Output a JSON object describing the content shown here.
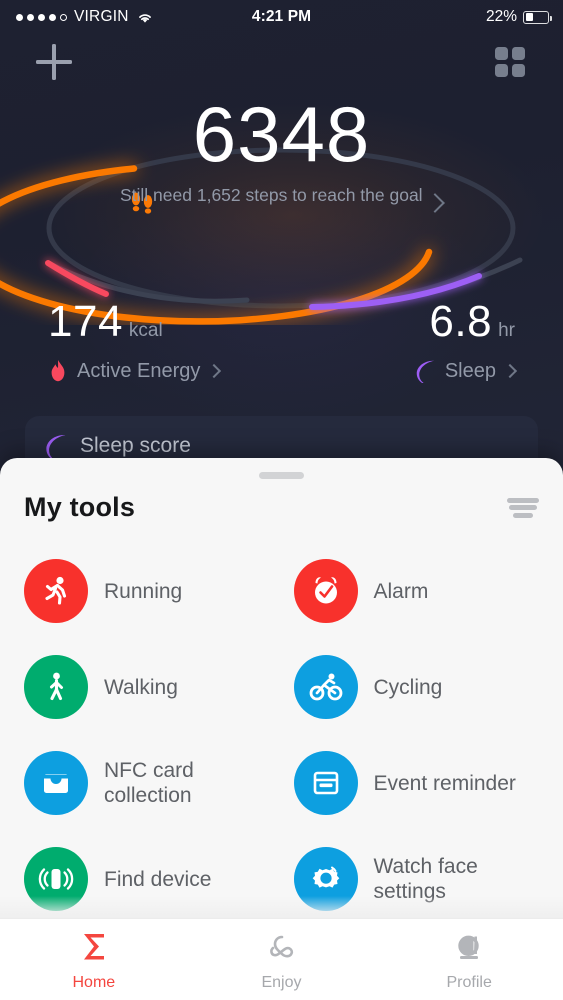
{
  "status_bar": {
    "carrier": "VIRGIN",
    "signal_dots_filled": 4,
    "signal_dots_total": 5,
    "wifi_icon": "wifi-icon",
    "time": "4:21 PM",
    "battery_percent": "22%",
    "battery_level": 22
  },
  "header": {
    "add_icon": "plus-icon",
    "grid_icon": "grid-apps-icon"
  },
  "steps_card": {
    "value": "6348",
    "message": "Still need 1,652 steps to reach the goal",
    "footprints_icon": "footprints-icon",
    "chevron_icon": "chevron-right-icon",
    "ring_color": "#fb7905",
    "ring_track_color": "#353a4a",
    "progress_percent": 79
  },
  "stats": [
    {
      "value": "174",
      "unit": "kcal",
      "label": "Active Energy",
      "icon": "flame-icon",
      "color": "#f8485e",
      "chevron_icon": "chevron-right-icon"
    },
    {
      "value": "6.8",
      "unit": "hr",
      "label": "Sleep",
      "icon": "moon-icon",
      "color": "#9d5ef5",
      "chevron_icon": "chevron-right-icon"
    }
  ],
  "sleep_score_card": {
    "label": "Sleep score",
    "icon": "moon-icon"
  },
  "sheet": {
    "title": "My tools",
    "sort_icon": "sort-filter-icon",
    "handle": "drag-handle",
    "tools": [
      {
        "label": "Running",
        "icon": "running-icon",
        "color": "#f8312c"
      },
      {
        "label": "Alarm",
        "icon": "alarm-clock-icon",
        "color": "#f8312c"
      },
      {
        "label": "Walking",
        "icon": "walking-icon",
        "color": "#00ac6e"
      },
      {
        "label": "Cycling",
        "icon": "cycling-icon",
        "color": "#0d9fe0"
      },
      {
        "label": "NFC card collection",
        "icon": "nfc-card-icon",
        "color": "#0d9fe0"
      },
      {
        "label": "Event reminder",
        "icon": "event-reminder-icon",
        "color": "#0d9fe0"
      },
      {
        "label": "Find device",
        "icon": "find-device-icon",
        "color": "#00ac6e"
      },
      {
        "label": "Watch face settings",
        "icon": "watch-face-icon",
        "color": "#0d9fe0"
      }
    ]
  },
  "tab_bar": {
    "active_color": "#f4463f",
    "inactive_color": "#a6a8ac",
    "tabs": [
      {
        "label": "Home",
        "icon": "sigma-home-icon",
        "active": true
      },
      {
        "label": "Enjoy",
        "icon": "enjoy-loop-icon",
        "active": false
      },
      {
        "label": "Profile",
        "icon": "profile-glyph-icon",
        "active": false
      }
    ]
  }
}
